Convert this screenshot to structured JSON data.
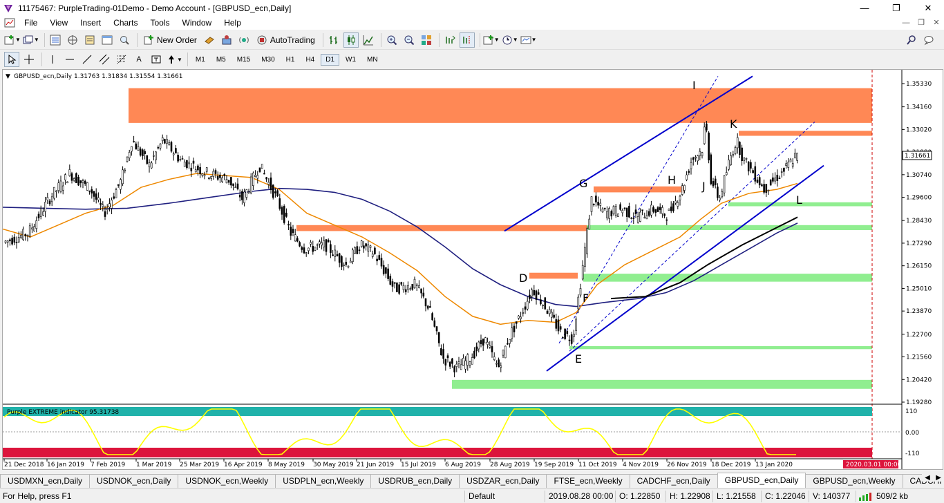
{
  "window": {
    "title": "11175467: PurpleTrading-01Demo - Demo Account - [GBPUSD_ecn,Daily]",
    "minimize": "—",
    "maximize": "❐",
    "close": "✕"
  },
  "menu": [
    "File",
    "View",
    "Insert",
    "Charts",
    "Tools",
    "Window",
    "Help"
  ],
  "toolbar": {
    "new_order": "New Order",
    "autotrading": "AutoTrading"
  },
  "timeframes": [
    "M1",
    "M5",
    "M15",
    "M30",
    "H1",
    "H4",
    "D1",
    "W1",
    "MN"
  ],
  "active_timeframe": "D1",
  "chart": {
    "header": "GBPUSD_ecn,Daily  1.31763 1.31834 1.31554 1.31661",
    "current_price": "1.31661",
    "price_ticks": [
      "1.35330",
      "1.34160",
      "1.33020",
      "1.31880",
      "1.30740",
      "1.29600",
      "1.28430",
      "1.27290",
      "1.26150",
      "1.25010",
      "1.23870",
      "1.22700",
      "1.21560",
      "1.20420",
      "1.19280"
    ],
    "date_ticks": [
      "21 Dec 2018",
      "16 Jan 2019",
      "7 Feb 2019",
      "1 Mar 2019",
      "25 Mar 2019",
      "16 Apr 2019",
      "8 May 2019",
      "30 May 2019",
      "21 Jun 2019",
      "15 Jul 2019",
      "6 Aug 2019",
      "28 Aug 2019",
      "19 Sep 2019",
      "11 Oct 2019",
      "4 Nov 2019",
      "26 Nov 2019",
      "18 Dec 2019",
      "13 Jan 2020"
    ],
    "future_date": "2020.03.01 00:00",
    "labels": [
      "I",
      "K",
      "G",
      "H",
      "J",
      "L",
      "D",
      "F",
      "E"
    ],
    "indicator": {
      "name": "Purple EXTREME indicator 95.31738",
      "levels": [
        "110",
        "0.00",
        "-110"
      ]
    },
    "colors": {
      "supply_zone": "#ff8855",
      "demand_zone": "#90ee90",
      "channel": "#0000cc",
      "ma_fast": "#ee8800",
      "ma_mid": "#202080",
      "ma_slow": "#000000",
      "candle": "#000000",
      "osc_line": "#ffff00",
      "osc_top_band": "#20b2aa",
      "osc_bottom_band": "#dc143c"
    }
  },
  "tabs": [
    "USDMXN_ecn,Daily",
    "USDNOK_ecn,Daily",
    "USDNOK_ecn,Weekly",
    "USDPLN_ecn,Weekly",
    "USDRUB_ecn,Daily",
    "USDZAR_ecn,Daily",
    "FTSE_ecn,Weekly",
    "CADCHF_ecn,Daily",
    "GBPUSD_ecn,Daily",
    "GBPUSD_ecn,Weekly",
    "CADCHF_ecn,"
  ],
  "active_tab": "GBPUSD_ecn,Daily",
  "status": {
    "help": "For Help, press F1",
    "profile": "Default",
    "datetime": "2019.08.28 00:00",
    "open": "O: 1.22850",
    "high": "H: 1.22908",
    "low": "L: 1.21558",
    "close": "C: 1.22046",
    "volume": "V: 140377",
    "traffic": "509/2 kb"
  }
}
